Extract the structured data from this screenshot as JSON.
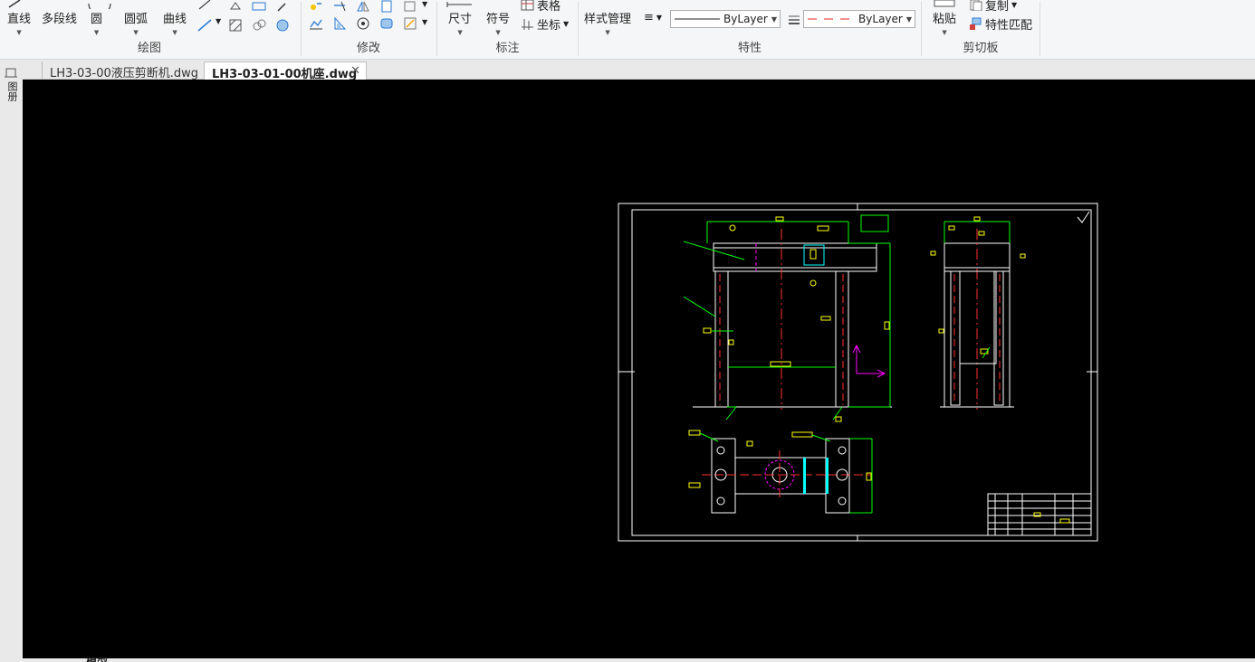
{
  "ribbon": {
    "draw": {
      "label": "绘图",
      "line": "直线",
      "polyline": "多段线",
      "circle": "圆",
      "arc": "圆弧",
      "curve": "曲线"
    },
    "modify": {
      "label": "修改"
    },
    "annotate": {
      "label": "标注",
      "dimension": "尺寸",
      "symbol": "符号",
      "table": "表格",
      "coordinate": "坐标"
    },
    "properties": {
      "label": "特性",
      "style_manager": "样式管理",
      "linetype": "ByLayer",
      "color": "ByLayer"
    },
    "clipboard": {
      "label": "剪切板",
      "paste": "粘贴",
      "copy": "复制",
      "match_properties": "特性匹配"
    }
  },
  "tabs": [
    {
      "label": "LH3-03-00液压剪断机.dwg",
      "active": false
    },
    {
      "label": "LH3-03-01-00机座.dwg",
      "active": true
    }
  ],
  "left_strip": {
    "label": "图册"
  },
  "layout_tabs": {
    "model": "模型"
  },
  "colors": {
    "canvas": "#000000",
    "accent_yellow": "#ffff00",
    "accent_green": "#00ff00",
    "accent_red": "#ff0000",
    "accent_cyan": "#00ffff",
    "accent_magenta": "#ff00ff"
  }
}
